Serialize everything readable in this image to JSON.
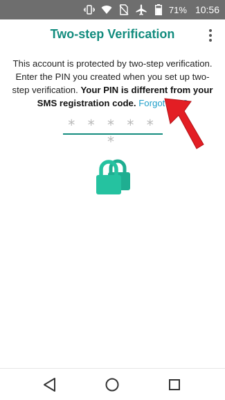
{
  "status_bar": {
    "battery_percent": "71%",
    "time": "10:56",
    "icons": [
      "vibrate-icon",
      "wifi-icon",
      "no-sim-icon",
      "airplane-mode-icon",
      "battery-icon"
    ]
  },
  "app_bar": {
    "title": "Two-step Verification",
    "menu_icon": "overflow-menu-icon"
  },
  "content": {
    "description_plain": "This account is protected by two-step verification. Enter the PIN you created when you set up two-step verification.",
    "description_bold": "Your PIN is different from your SMS registration code.",
    "forgot_link": "Forgot PIN?",
    "pin_placeholder": "* * *   * * *",
    "illustration_icon": "padlock-icon",
    "annotation_icon": "red-arrow-icon"
  },
  "nav_bar": {
    "icons": [
      "back-icon",
      "home-icon",
      "recents-icon"
    ]
  },
  "colors": {
    "accent": "#128c7e",
    "lock": "#25c2a0",
    "link": "#1e9fc9",
    "status_bar": "#6e6e6e",
    "annotation": "#e31e24"
  }
}
